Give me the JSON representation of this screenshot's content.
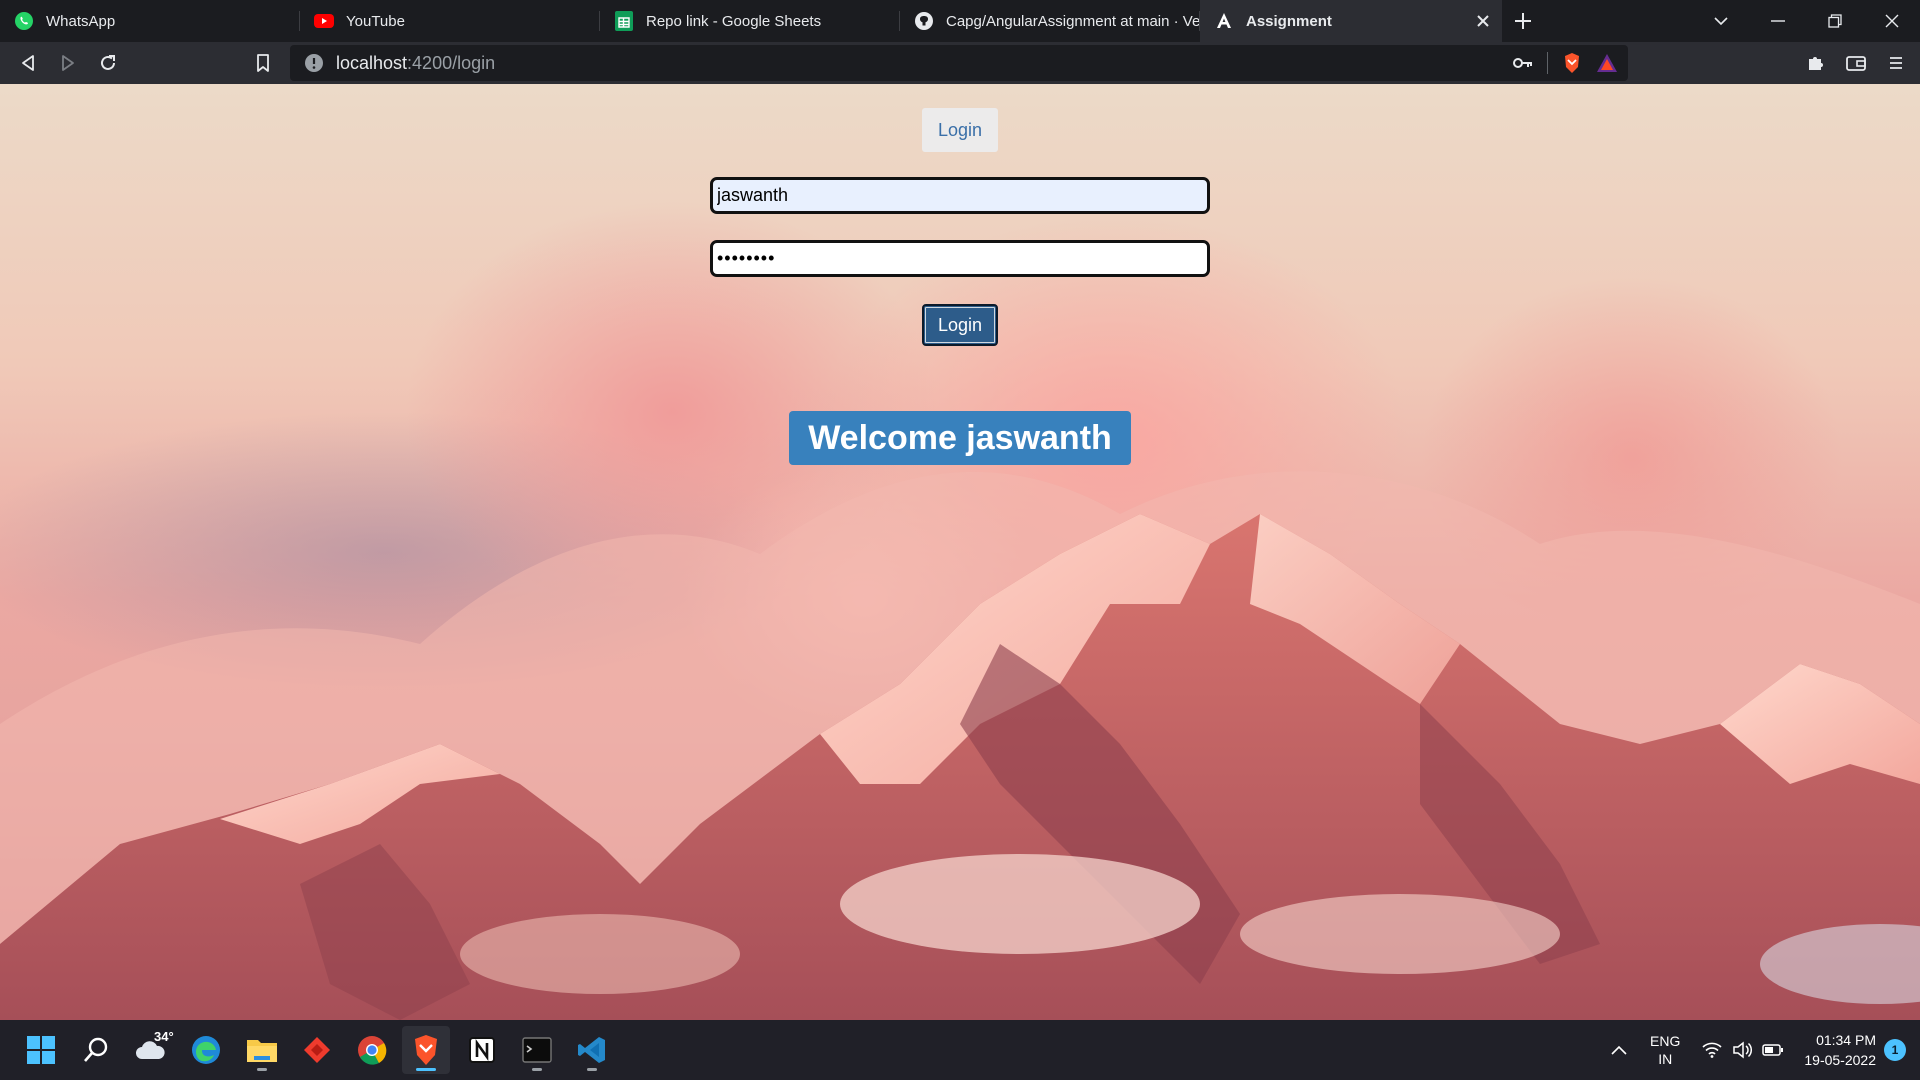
{
  "browser": {
    "tabs": [
      {
        "title": "WhatsApp",
        "icon": "whatsapp-icon"
      },
      {
        "title": "YouTube",
        "icon": "youtube-icon"
      },
      {
        "title": "Repo link - Google Sheets",
        "icon": "google-sheets-icon"
      },
      {
        "title": "Capg/AngularAssignment at main · Ve",
        "icon": "github-icon"
      },
      {
        "title": "Assignment",
        "icon": "angular-icon",
        "active": true
      }
    ],
    "url_host": "localhost",
    "url_path": ":4200/login"
  },
  "page": {
    "nav_login_label": "Login",
    "username_value": "jaswanth",
    "password_value": "••••••••",
    "login_button_label": "Login",
    "welcome_text": "Welcome jaswanth"
  },
  "taskbar": {
    "weather_temp": "34°",
    "apps": [
      "start-icon",
      "search-icon",
      "weather-icon",
      "edge-icon",
      "file-explorer-icon",
      "anydesk-icon",
      "chrome-icon",
      "brave-icon",
      "notion-icon",
      "terminal-icon",
      "vscode-icon"
    ],
    "lang_primary": "ENG",
    "lang_secondary": "IN",
    "time": "01:34 PM",
    "date": "19-05-2022",
    "notification_count": "1"
  },
  "colors": {
    "welcome_bg": "#3881bd",
    "login_btn_bg": "#2d5c8a",
    "brave_orange": "#fb542b"
  }
}
